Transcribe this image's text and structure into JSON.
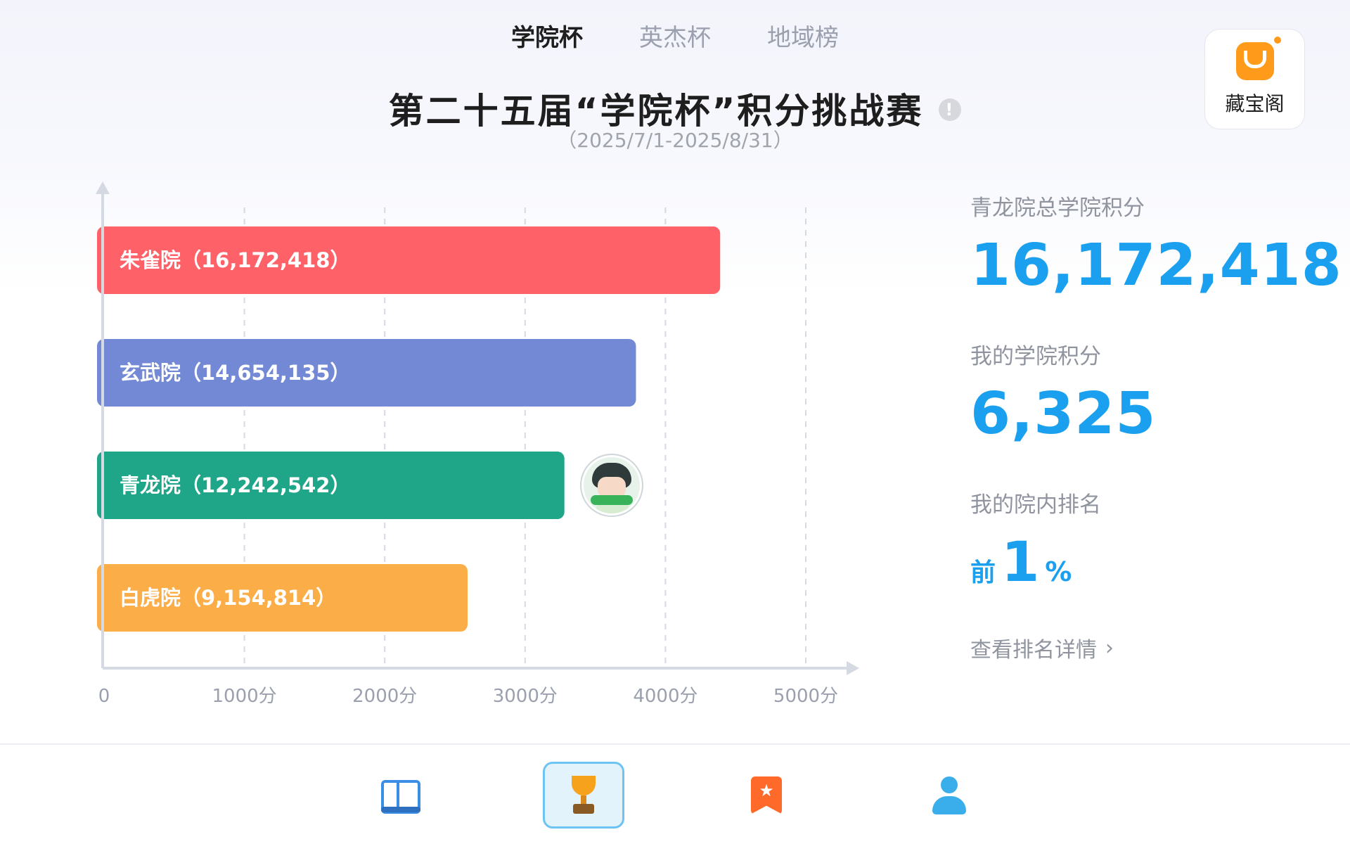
{
  "tabs": [
    {
      "label": "学院杯",
      "active": true
    },
    {
      "label": "英杰杯",
      "active": false
    },
    {
      "label": "地域榜",
      "active": false
    }
  ],
  "treasure": {
    "label": "藏宝阁",
    "icon": "treasure-bag-icon"
  },
  "header": {
    "title": "第二十五届“学院杯”积分挑战赛",
    "dates": "（2025/7/1-2025/8/31）",
    "info_icon": "info-icon"
  },
  "chart_data": {
    "type": "bar",
    "orientation": "horizontal",
    "categories": [
      "朱雀院（16,172,418）",
      "玄武院（14,654,135）",
      "青龙院（12,242,542）",
      "白虎院（9,154,814）"
    ],
    "values": [
      4390,
      3790,
      3280,
      2590
    ],
    "colors": [
      "#ff6169",
      "#7389d5",
      "#1fa588",
      "#fbad48"
    ],
    "xticks": [
      "0",
      "1000分",
      "2000分",
      "3000分",
      "4000分",
      "5000分"
    ],
    "xlim": [
      0,
      5000
    ],
    "grid": "vertical-dashed",
    "marker": {
      "category_index": 2,
      "icon": "user-avatar-icon"
    }
  },
  "stats": {
    "total_label": "青龙院总学院积分",
    "total_value": "16,172,418",
    "my_label": "我的学院积分",
    "my_value": "6,325",
    "rank_label": "我的院内排名",
    "rank_prefix": "前",
    "rank_value": "1",
    "rank_suffix": "%",
    "detail_link": "查看排名详情"
  },
  "colors": {
    "accent": "#1aa0ee",
    "active_tab": "#1e1e1e",
    "inactive_tab": "#9aa0ad"
  },
  "nav": [
    {
      "name": "book-icon",
      "active": false
    },
    {
      "name": "trophy-icon",
      "active": true
    },
    {
      "name": "bookmark-star-icon",
      "active": false
    },
    {
      "name": "profile-icon",
      "active": false
    }
  ]
}
